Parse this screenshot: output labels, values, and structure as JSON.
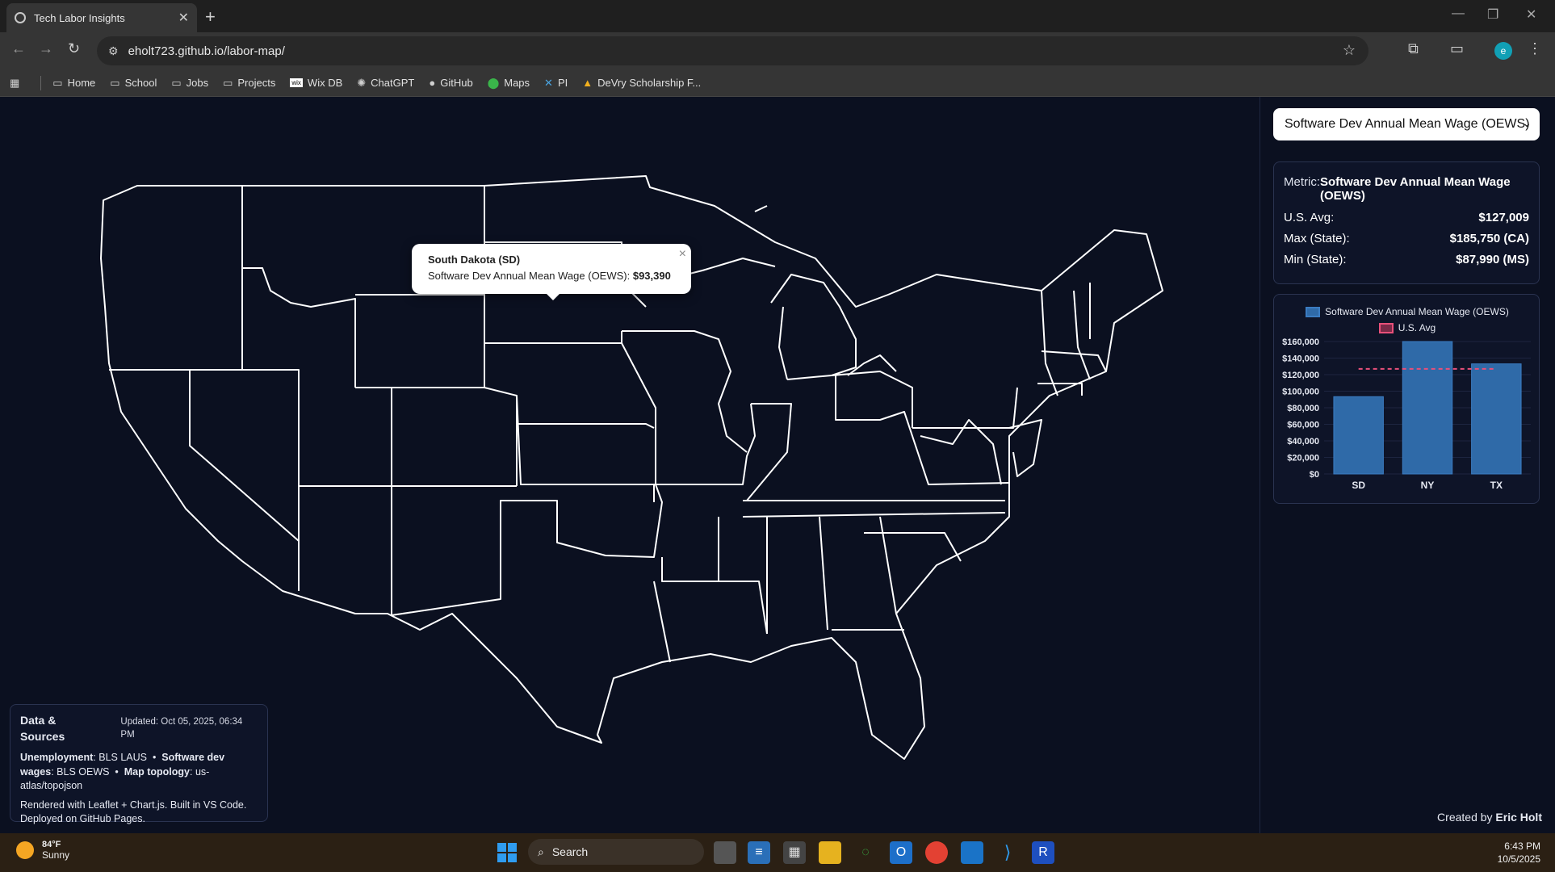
{
  "browser": {
    "tab_title": "Tech Labor Insights",
    "url": "eholt723.github.io/labor-map/",
    "bookmarks": [
      "Home",
      "School",
      "Jobs",
      "Projects",
      "Wix DB",
      "ChatGPT",
      "GitHub",
      "Maps",
      "PI",
      "DeVry Scholarship F..."
    ]
  },
  "popup": {
    "title": "South Dakota (SD)",
    "label": "Software Dev Annual Mean Wage (OEWS): ",
    "value": "$93,390"
  },
  "sources": {
    "title": "Data & Sources",
    "updated": "Updated: Oct 05, 2025, 06:34 PM",
    "unemployment_label": "Unemployment",
    "unemployment_value": ": BLS LAUS",
    "wages_label": "Software dev wages",
    "wages_value": ": BLS OEWS",
    "topology_label": "Map topology",
    "topology_value": ": us-atlas/topojson",
    "footer": "Rendered with Leaflet + Chart.js. Built in VS Code. Deployed on GitHub Pages."
  },
  "sidebar": {
    "select_value": "Software Dev Annual Mean Wage (OEWS)",
    "metric_label": "Metric:",
    "metric_value": "Software Dev Annual Mean Wage (OEWS)",
    "us_avg_label": "U.S. Avg:",
    "us_avg_value": "$127,009",
    "max_label": "Max (State):",
    "max_value": "$185,750 (CA)",
    "min_label": "Min (State):",
    "min_value": "$87,990 (MS)",
    "credit_prefix": "Created by ",
    "credit_name": "Eric Holt"
  },
  "chart_data": {
    "type": "bar",
    "categories": [
      "SD",
      "NY",
      "TX"
    ],
    "series": [
      {
        "name": "Software Dev Annual Mean Wage (OEWS)",
        "values": [
          93390,
          160000,
          133000
        ],
        "color": "#2f6aa8"
      },
      {
        "name": "U.S. Avg",
        "values": [
          127009,
          127009,
          127009
        ],
        "color": "#e8507a",
        "style": "dashed-line"
      }
    ],
    "ylim": [
      0,
      160000
    ],
    "yticks": [
      "$0",
      "$20,000",
      "$40,000",
      "$60,000",
      "$80,000",
      "$100,000",
      "$120,000",
      "$140,000",
      "$160,000"
    ],
    "legend": "top"
  },
  "taskbar": {
    "temp": "84°F",
    "condition": "Sunny",
    "search": "Search",
    "time": "6:43 PM",
    "date": "10/5/2025"
  }
}
